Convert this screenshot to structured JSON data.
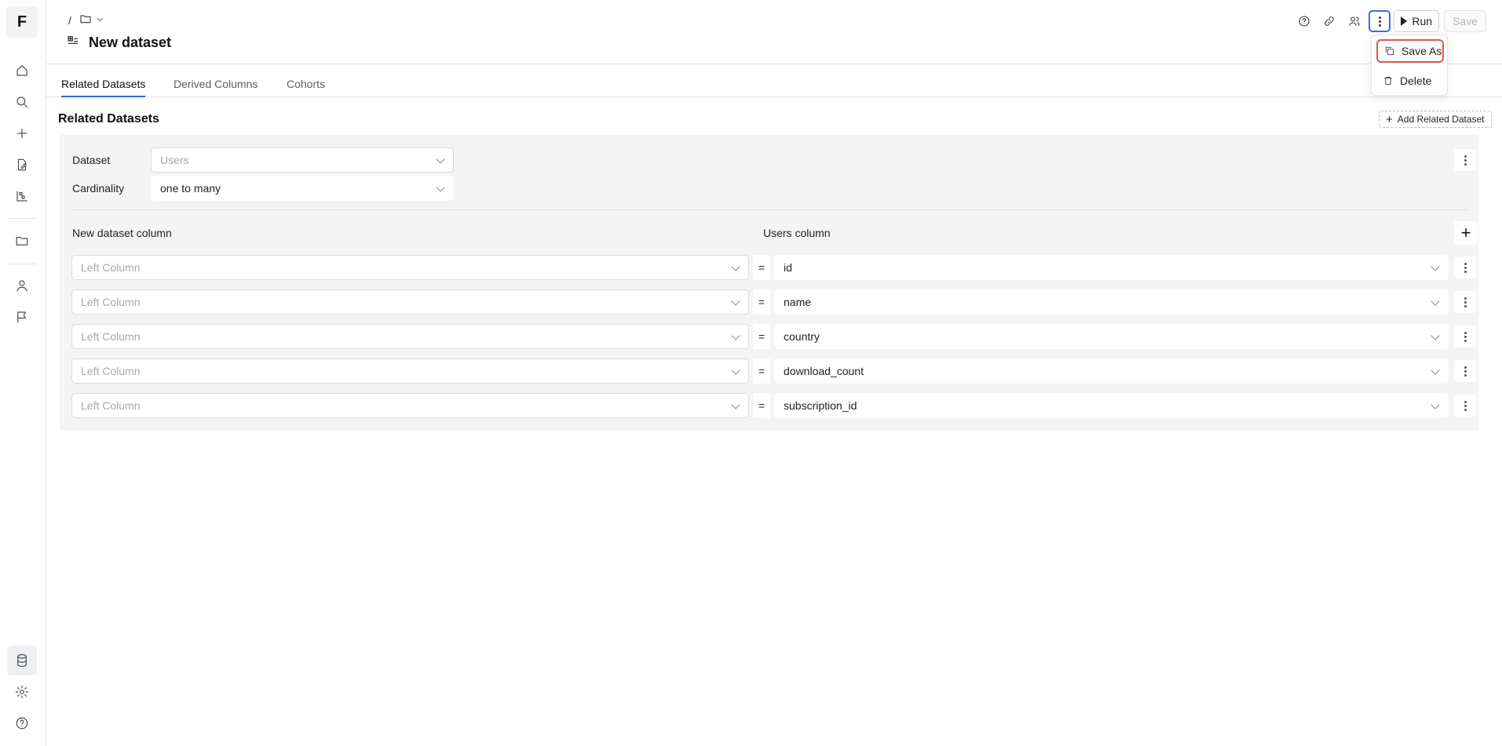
{
  "sidebar": {
    "logo": "F",
    "icons": [
      "home-icon",
      "search-icon",
      "plus-icon",
      "edit-file-icon",
      "chart-icon",
      "folder-icon",
      "user-icon",
      "flag-icon",
      "database-icon",
      "gear-icon",
      "help-icon"
    ]
  },
  "header": {
    "breadcrumb_separator": "/",
    "title": "New dataset",
    "toolbar": {
      "run_label": "Run",
      "save_label": "Save"
    }
  },
  "menu": {
    "items": [
      "Save As",
      "Delete"
    ]
  },
  "tabs": [
    "Related Datasets",
    "Derived Columns",
    "Cohorts"
  ],
  "section": {
    "title": "Related Datasets",
    "add_label": "Add Related Dataset",
    "dataset_label": "Dataset",
    "dataset_placeholder": "Users",
    "cardinality_label": "Cardinality",
    "cardinality_value": "one to many",
    "left_header": "New dataset column",
    "right_header": "Users column",
    "rows": [
      {
        "left_placeholder": "Left Column",
        "eq": "=",
        "right": "id"
      },
      {
        "left_placeholder": "Left Column",
        "eq": "=",
        "right": "name"
      },
      {
        "left_placeholder": "Left Column",
        "eq": "=",
        "right": "country"
      },
      {
        "left_placeholder": "Left Column",
        "eq": "=",
        "right": "download_count"
      },
      {
        "left_placeholder": "Left Column",
        "eq": "=",
        "right": "subscription_id"
      }
    ]
  },
  "colors": {
    "accent": "#2f6ed6",
    "highlight": "#e0574a"
  }
}
